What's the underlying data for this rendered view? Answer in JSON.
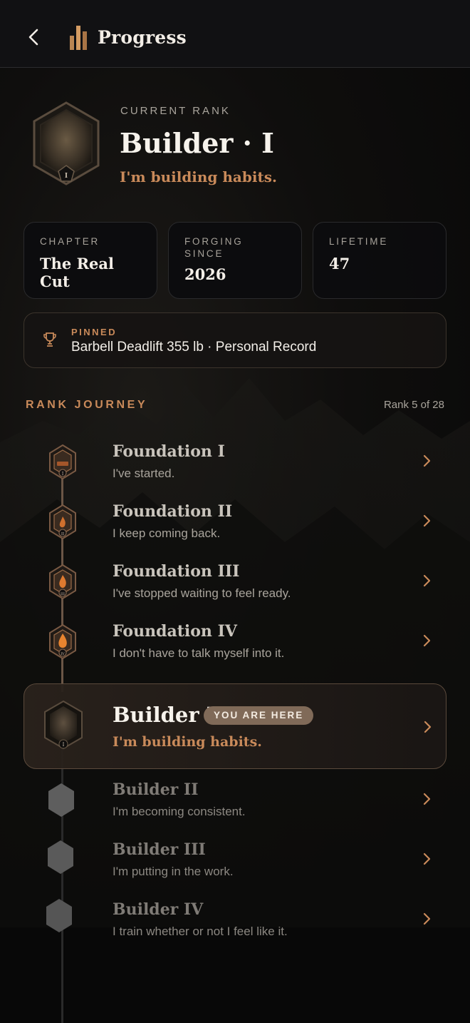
{
  "header": {
    "title": "Progress",
    "back_icon": "chevron-left-icon",
    "logo_icon": "pillars-logo-icon"
  },
  "current_rank": {
    "label": "CURRENT RANK",
    "title": "Builder · I",
    "subtitle": "I'm building habits.",
    "badge_numeral": "I"
  },
  "stats": [
    {
      "label": "CHAPTER",
      "value": "The Real Cut"
    },
    {
      "label": "FORGING\nSINCE",
      "value": "2026"
    },
    {
      "label": "LIFETIME",
      "value": "47"
    }
  ],
  "pinned": {
    "label": "PINNED",
    "text": "Barbell Deadlift 355 lb · Personal Record",
    "icon": "trophy-icon"
  },
  "journey": {
    "label": "RANK JOURNEY",
    "count": "Rank 5 of 28",
    "ranks": [
      {
        "title": "Foundation I",
        "desc": "I've started.",
        "numeral": "I",
        "state": "done"
      },
      {
        "title": "Foundation II",
        "desc": "I keep coming back.",
        "numeral": "II",
        "state": "done"
      },
      {
        "title": "Foundation III",
        "desc": "I've stopped waiting to feel ready.",
        "numeral": "III",
        "state": "done"
      },
      {
        "title": "Foundation IV",
        "desc": "I don't have to talk myself into it.",
        "numeral": "IV",
        "state": "done"
      },
      {
        "title": "Builder I",
        "desc": "I'm building habits.",
        "numeral": "I",
        "state": "current",
        "badge_text": "YOU ARE HERE"
      },
      {
        "title": "Builder II",
        "desc": "I'm becoming consistent.",
        "state": "locked"
      },
      {
        "title": "Builder III",
        "desc": "I'm putting in the work.",
        "state": "locked"
      },
      {
        "title": "Builder IV",
        "desc": "I train whether or not I feel like it.",
        "state": "locked"
      }
    ]
  },
  "colors": {
    "accent": "#c98a5a",
    "background": "#0b0b0c",
    "card_border": "#2a2a2c",
    "pill": "#806a58"
  }
}
